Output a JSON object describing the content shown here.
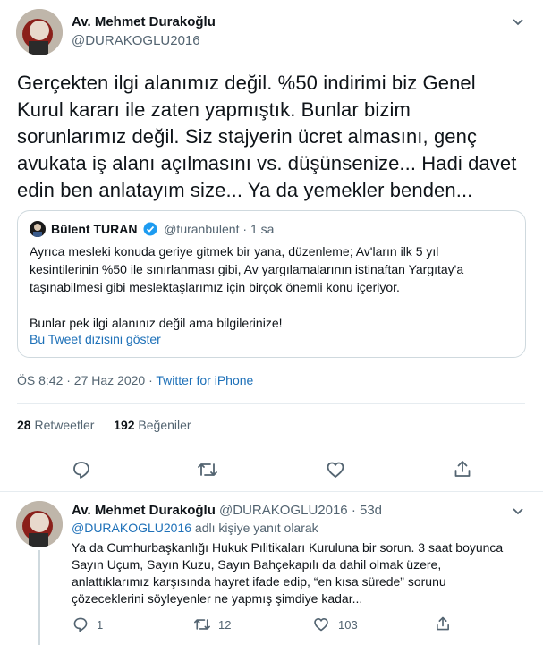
{
  "tweet": {
    "author_name": "Av. Mehmet Durakoğlu",
    "author_handle": "@DURAKOGLU2016",
    "text_lines": [
      "Gerçekten ilgi alanımız değil. %50 indirimi biz Genel",
      "Kurul kararı ile zaten yapmıştık. Bunlar bizim",
      "sorunlarımız değil. Siz stajyerin ücret almasını, genç",
      "avukata iş alanı açılmasını vs. düşünsenize... Hadi davet",
      "edin ben anlatayım size... Ya da yemekler benden..."
    ],
    "timestamp": "ÖS 8:42 · 27 Haz 2020 · ",
    "source": "Twitter for iPhone",
    "retweets_count": "28",
    "retweets_label": "Retweetler",
    "likes_count": "192",
    "likes_label": "Beğeniler"
  },
  "quoted": {
    "author_name": "Bülent TURAN",
    "author_handle": "@turanbulent",
    "time": " · 1 sa",
    "lines": [
      "Ayrıca mesleki konuda geriye gitmek bir yana, düzenleme; Av'ların ilk 5 yıl",
      "kesintilerinin %50 ile sınırlanması gibi, Av yargılamalarının istinaftan Yargıtay'a",
      "taşınabilmesi gibi meslektaşlarımız için birçok önemli konu içeriyor.",
      "Bunlar pek ilgi alanınız değil ama bilgilerinize!"
    ],
    "show_thread": "Bu Tweet dizisini göster"
  },
  "reply": {
    "author_name": "Av. Mehmet Durakoğlu",
    "author_handle": "@DURAKOGLU2016",
    "time": "· 53d",
    "replying_handle": "@DURAKOGLU2016",
    "replying_label": " adlı kişiye yanıt olarak",
    "lines": [
      "Ya da Cumhurbaşkanlığı Hukuk Pılitikaları Kuruluna bir sorun. 3 saat boyunca",
      "Sayın Uçum, Sayın Kuzu, Sayın Bahçekapılı da dahil olmak üzere,",
      "anlattıklarımız karşısında hayret ifade edip, “en kısa sürede” sorunu",
      "çözeceklerini söyleyenler ne yapmış şimdiye kadar..."
    ],
    "reply_count": "1",
    "retweet_count": "12",
    "like_count": "103"
  },
  "colors": {
    "link": "#1d70b8",
    "verified": "#1d9bf0",
    "muted": "#536471"
  }
}
